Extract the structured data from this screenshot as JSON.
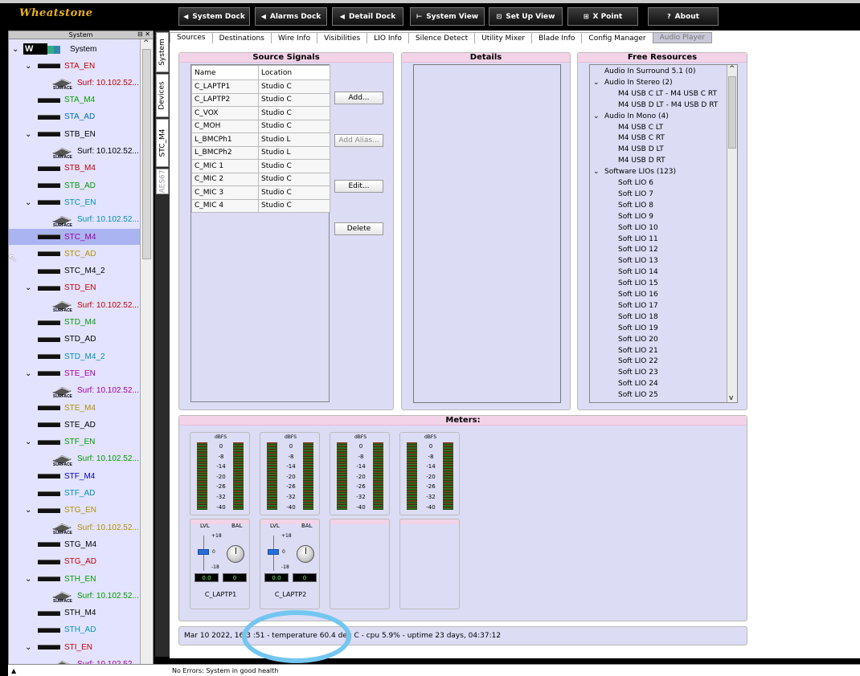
{
  "app": {
    "logo": "Wheatstone"
  },
  "toolbar": {
    "buttons": [
      {
        "label": "System Dock",
        "icon": "◀"
      },
      {
        "label": "Alarms Dock",
        "icon": "◀"
      },
      {
        "label": "Detail Dock",
        "icon": "◀"
      },
      {
        "label": "System View",
        "icon": "⊢"
      },
      {
        "label": "Set Up View",
        "icon": "⊡"
      },
      {
        "label": "X Point",
        "icon": "⊞"
      },
      {
        "label": "About",
        "icon": "?"
      }
    ]
  },
  "sidebar": {
    "title": "System",
    "root": "System",
    "items": [
      {
        "kind": "device",
        "label": "STA_EN",
        "color": "#c00000",
        "expandable": true
      },
      {
        "kind": "surface",
        "label": "Surf: 10.102.52...",
        "color": "#c00000"
      },
      {
        "kind": "device",
        "label": "STA_M4",
        "color": "#009a00"
      },
      {
        "kind": "device",
        "label": "STA_AD",
        "color": "#0070c0"
      },
      {
        "kind": "device",
        "label": "STB_EN",
        "color": "#000000",
        "expandable": true
      },
      {
        "kind": "surface",
        "label": "Surf: 10.102.52...",
        "color": "#000000"
      },
      {
        "kind": "device",
        "label": "STB_M4",
        "color": "#c00000"
      },
      {
        "kind": "device",
        "label": "STB_AD",
        "color": "#009a00"
      },
      {
        "kind": "device",
        "label": "STC_EN",
        "color": "#0090b0",
        "expandable": true
      },
      {
        "kind": "surface",
        "label": "Surf: 10.102.52...",
        "color": "#0090b0"
      },
      {
        "kind": "device",
        "label": "STC_M4",
        "color": "#a000a0",
        "selected": true
      },
      {
        "kind": "device",
        "label": "STC_AD",
        "color": "#b09000"
      },
      {
        "kind": "device",
        "label": "STC_M4_2",
        "color": "#000000"
      },
      {
        "kind": "device",
        "label": "STD_EN",
        "color": "#c00000",
        "expandable": true
      },
      {
        "kind": "surface",
        "label": "Surf: 10.102.52...",
        "color": "#c00000"
      },
      {
        "kind": "device",
        "label": "STD_M4",
        "color": "#009a00"
      },
      {
        "kind": "device",
        "label": "STD_AD",
        "color": "#000000"
      },
      {
        "kind": "device",
        "label": "STD_M4_2",
        "color": "#0090b0"
      },
      {
        "kind": "device",
        "label": "STE_EN",
        "color": "#a000a0",
        "expandable": true
      },
      {
        "kind": "surface",
        "label": "Surf: 10.102.52...",
        "color": "#a000a0"
      },
      {
        "kind": "device",
        "label": "STE_M4",
        "color": "#b09000"
      },
      {
        "kind": "device",
        "label": "STE_AD",
        "color": "#000000"
      },
      {
        "kind": "device",
        "label": "STF_EN",
        "color": "#009a00",
        "expandable": true
      },
      {
        "kind": "surface",
        "label": "Surf: 10.102.52...",
        "color": "#009a00"
      },
      {
        "kind": "device",
        "label": "STF_M4",
        "color": "#0000c0"
      },
      {
        "kind": "device",
        "label": "STF_AD",
        "color": "#0090b0"
      },
      {
        "kind": "device",
        "label": "STG_EN",
        "color": "#b09000",
        "expandable": true
      },
      {
        "kind": "surface",
        "label": "Surf: 10.102.52...",
        "color": "#b09000"
      },
      {
        "kind": "device",
        "label": "STG_M4",
        "color": "#000000"
      },
      {
        "kind": "device",
        "label": "STG_AD",
        "color": "#c00000"
      },
      {
        "kind": "device",
        "label": "STH_EN",
        "color": "#009a00",
        "expandable": true
      },
      {
        "kind": "surface",
        "label": "Surf: 10.102.52...",
        "color": "#009a00"
      },
      {
        "kind": "device",
        "label": "STH_M4",
        "color": "#000000"
      },
      {
        "kind": "device",
        "label": "STH_AD",
        "color": "#0090b0"
      },
      {
        "kind": "device",
        "label": "STI_EN",
        "color": "#c00000",
        "expandable": true
      },
      {
        "kind": "surface",
        "label": "Surf: 10.102.52...",
        "color": "#a000a0"
      }
    ]
  },
  "vtabs": [
    "System",
    "Devices",
    "STC_M4",
    "AES67"
  ],
  "tabs": [
    "Sources",
    "Destinations",
    "Wire Info",
    "Visibilities",
    "LIO Info",
    "Silence Detect",
    "Utility Mixer",
    "Blade Info",
    "Config Manager",
    "Audio Player"
  ],
  "source_signals": {
    "title": "Source Signals",
    "columns": [
      "Name",
      "Location"
    ],
    "rows": [
      [
        "C_LAPTP1",
        "Studio C"
      ],
      [
        "C_LAPTP2",
        "Studio C"
      ],
      [
        "C_VOX",
        "Studio C"
      ],
      [
        "C_MOH",
        "Studio C"
      ],
      [
        "L_BMCPh1",
        "Studio L"
      ],
      [
        "L_BMCPh2",
        "Studio L"
      ],
      [
        "C_MIC 1",
        "Studio C"
      ],
      [
        "C_MIC 2",
        "Studio C"
      ],
      [
        "C_MIC 3",
        "Studio C"
      ],
      [
        "C_MIC 4",
        "Studio C"
      ]
    ],
    "buttons": {
      "add": "Add...",
      "alias": "Add Alias...",
      "edit": "Edit...",
      "delete": "Delete"
    }
  },
  "details": {
    "title": "Details"
  },
  "free_resources": {
    "title": "Free Resources",
    "items": [
      {
        "label": "Audio In Surround 5.1 (0)",
        "level": 0,
        "exp": false
      },
      {
        "label": "Audio In Stereo (2)",
        "level": 0,
        "exp": true
      },
      {
        "label": "M4 USB C LT - M4 USB C RT",
        "level": 1
      },
      {
        "label": "M4 USB D LT - M4 USB D RT",
        "level": 1
      },
      {
        "label": "Audio In Mono (4)",
        "level": 0,
        "exp": true
      },
      {
        "label": "M4 USB C LT",
        "level": 1
      },
      {
        "label": "M4 USB C RT",
        "level": 1
      },
      {
        "label": "M4 USB D LT",
        "level": 1
      },
      {
        "label": "M4 USB D RT",
        "level": 1
      },
      {
        "label": "Software LIOs (123)",
        "level": 0,
        "exp": true
      },
      {
        "label": "Soft LIO 6",
        "level": 1
      },
      {
        "label": "Soft LIO 7",
        "level": 1
      },
      {
        "label": "Soft LIO 8",
        "level": 1
      },
      {
        "label": "Soft LIO 9",
        "level": 1
      },
      {
        "label": "Soft LIO 10",
        "level": 1
      },
      {
        "label": "Soft LIO 11",
        "level": 1
      },
      {
        "label": "Soft LIO 12",
        "level": 1
      },
      {
        "label": "Soft LIO 13",
        "level": 1
      },
      {
        "label": "Soft LIO 14",
        "level": 1
      },
      {
        "label": "Soft LIO 15",
        "level": 1
      },
      {
        "label": "Soft LIO 16",
        "level": 1
      },
      {
        "label": "Soft LIO 17",
        "level": 1
      },
      {
        "label": "Soft LIO 18",
        "level": 1
      },
      {
        "label": "Soft LIO 19",
        "level": 1
      },
      {
        "label": "Soft LIO 20",
        "level": 1
      },
      {
        "label": "Soft LIO 21",
        "level": 1
      },
      {
        "label": "Soft LIO 22",
        "level": 1
      },
      {
        "label": "Soft LIO 23",
        "level": 1
      },
      {
        "label": "Soft LIO 24",
        "level": 1
      },
      {
        "label": "Soft LIO 25",
        "level": 1
      }
    ]
  },
  "meters": {
    "title": "Meters:",
    "scale_label": "dBFS",
    "ticks": [
      "0",
      "-8",
      "-14",
      "-20",
      "-26",
      "-32",
      "-40"
    ],
    "channels": [
      {
        "name": "C_LAPTP1",
        "lvl": "LVL",
        "bal": "BAL",
        "plus": "+18",
        "zero": "0",
        "minus": "-18",
        "v1": "0.0",
        "v2": "0"
      },
      {
        "name": "C_LAPTP2",
        "lvl": "LVL",
        "bal": "BAL",
        "plus": "+18",
        "zero": "0",
        "minus": "-18",
        "v1": "0.0",
        "v2": "0"
      },
      {
        "name": ""
      },
      {
        "name": ""
      }
    ]
  },
  "info_line": "Mar 10 2022, 16:3 :51 - temperature 60.4 deg C - cpu 5.9% - uptime 23 days, 04:37:12",
  "status": "No Errors: System in good health"
}
